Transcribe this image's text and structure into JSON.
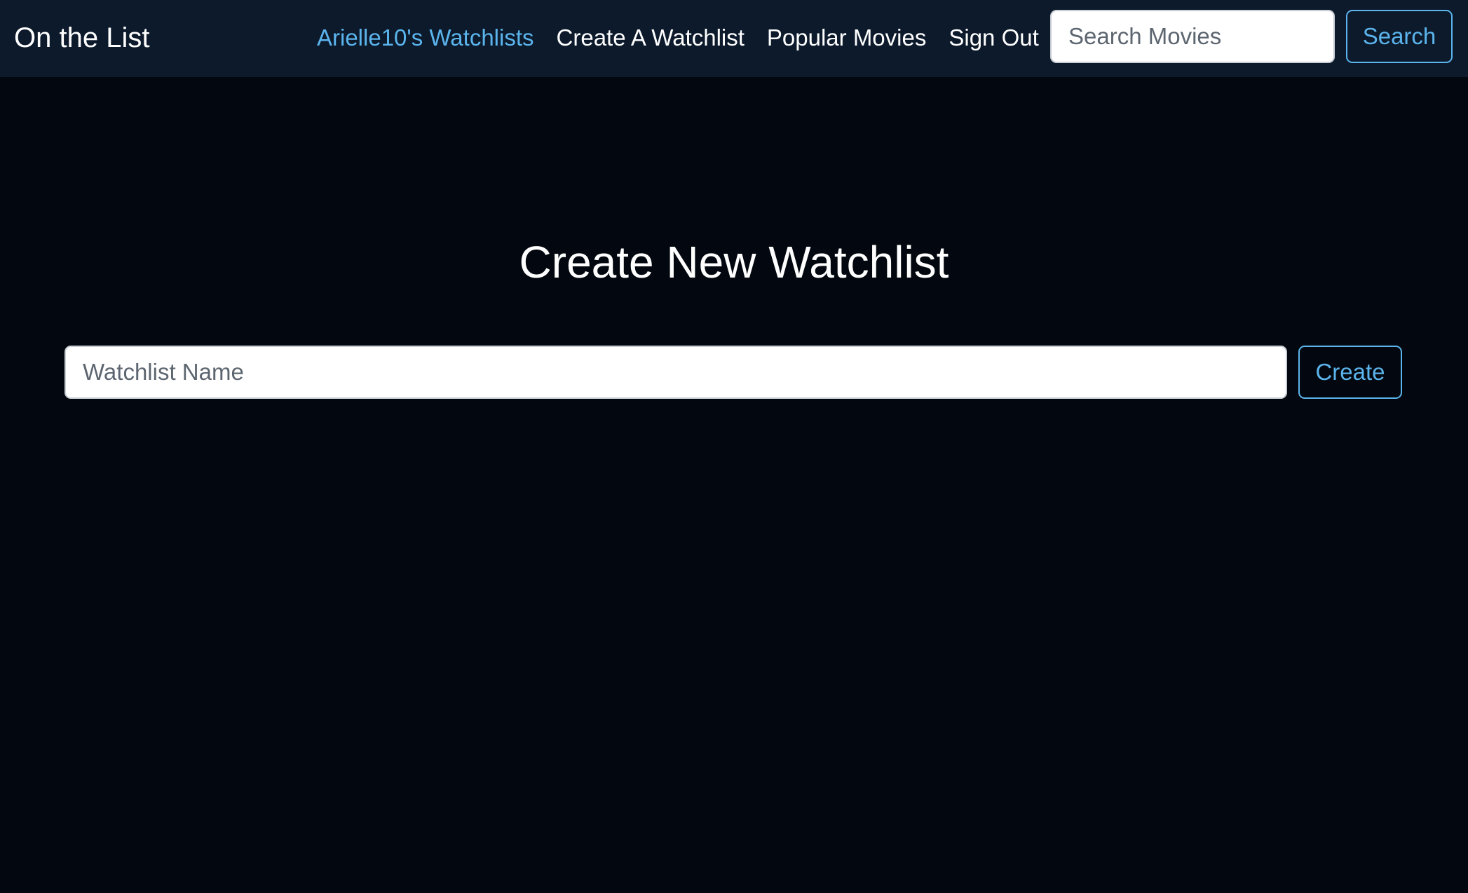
{
  "navbar": {
    "brand": "On the List",
    "links": [
      {
        "label": "Arielle10's Watchlists",
        "active": true
      },
      {
        "label": "Create A Watchlist",
        "active": false
      },
      {
        "label": "Popular Movies",
        "active": false
      },
      {
        "label": "Sign Out",
        "active": false
      }
    ],
    "search": {
      "placeholder": "Search Movies",
      "value": "",
      "button_label": "Search"
    }
  },
  "main": {
    "title": "Create New Watchlist",
    "form": {
      "name_placeholder": "Watchlist Name",
      "name_value": "",
      "create_label": "Create"
    }
  },
  "colors": {
    "navbar_bg": "#0c1a2c",
    "page_bg": "#030810",
    "accent": "#5bb4ec",
    "text": "#ffffff"
  }
}
